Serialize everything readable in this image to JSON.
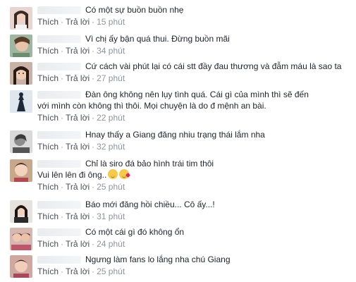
{
  "labels": {
    "like": "Thích",
    "reply": "Trả lời",
    "separator": "·"
  },
  "comments": [
    {
      "text": "Có một sự buồn buồn nhẹ",
      "time": "15 phút"
    },
    {
      "text": "Vì chị ấy bận quá thui. Đừng buồn mãi",
      "time": "34 phút"
    },
    {
      "text": "Cứ cách vài phút lại có cái stt đầy đau thương và đẫm máu là sao ta",
      "time": "27 phút"
    },
    {
      "text": "Đàn ông không nên lụy tình quá. Cái gì của mình thì sẽ đến",
      "text2": "với mình còn không thì thôi. Mọi chuyện là do đ mệnh an bài.",
      "time": "22 phút"
    },
    {
      "text": "Hnay thấy a Giang đăng nhiu trạng thái lắm nha",
      "time": "32 phút"
    },
    {
      "text": "Chỉ là siro đá bảo hình trái tim thôi",
      "text2": "Vui lên lên đi ông..",
      "time": "25 phút",
      "emoji": [
        "tongue-face-emoji",
        "kiss-face-emoji"
      ]
    },
    {
      "text": "Báo mới đăng hồi chiều... Cô ấy...!",
      "time": "31 phút"
    },
    {
      "text": "Có một cái gì đó không ổn",
      "time": "24 phút"
    },
    {
      "text": "Ngưng làm fans lo lắng nha chú Giang",
      "time": "25 phút"
    }
  ],
  "colors": {
    "link": "#4b4f56",
    "meta": "#90949c",
    "text": "#1d2129"
  }
}
